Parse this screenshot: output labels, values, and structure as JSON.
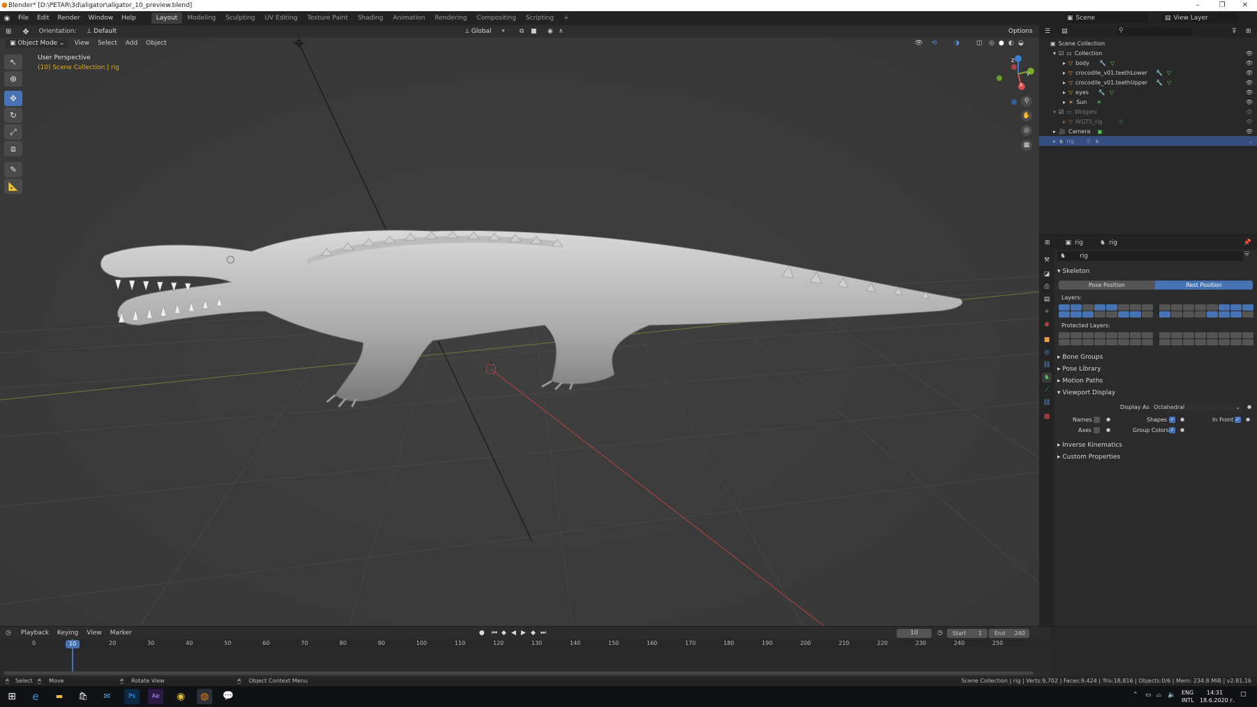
{
  "window": {
    "title": "Blender* [D:\\PETAR\\3d\\aligator\\aligator_10_preview.blend]"
  },
  "menu": [
    "File",
    "Edit",
    "Render",
    "Window",
    "Help"
  ],
  "workspaces": [
    "Layout",
    "Modeling",
    "Sculpting",
    "UV Editing",
    "Texture Paint",
    "Shading",
    "Animation",
    "Rendering",
    "Compositing",
    "Scripting"
  ],
  "scene_field": "Scene",
  "view_layer_field": "View Layer",
  "viewport": {
    "orientation_label": "Orientation:",
    "orientation_value": "Default",
    "transform_space": "Global",
    "options_label": "Options",
    "mode": "Object Mode",
    "header_menu": [
      "View",
      "Select",
      "Add",
      "Object"
    ],
    "overlay_title": "User Perspective",
    "overlay_sub": "(10) Scene Collection | rig",
    "gizmo_labels": {
      "z": "Z",
      "y": "Y",
      "x": "X"
    }
  },
  "outliner": {
    "rows": [
      {
        "label": "Scene Collection",
        "indent": 0
      },
      {
        "label": "Collection",
        "indent": 1
      },
      {
        "label": "body",
        "indent": 2
      },
      {
        "label": "crocodile_v01.teethLower",
        "indent": 2
      },
      {
        "label": "crocodile_v01.teethUpper",
        "indent": 2
      },
      {
        "label": "eyes",
        "indent": 2
      },
      {
        "label": "Sun",
        "indent": 2
      },
      {
        "label": "Widgets",
        "indent": 1
      },
      {
        "label": "WGTS_rig",
        "indent": 2
      },
      {
        "label": "Camera",
        "indent": 1
      },
      {
        "label": "rig",
        "indent": 1
      }
    ]
  },
  "properties": {
    "breadcrumb_object": "rig",
    "breadcrumb_data": "rig",
    "name_field": "rig",
    "skeleton_title": "Skeleton",
    "pose_position": "Pose Position",
    "rest_position": "Rest Position",
    "layers_label": "Layers:",
    "protected_layers_label": "Protected Layers:",
    "collapsed_panels": [
      "Bone Groups",
      "Pose Library",
      "Motion Paths"
    ],
    "viewport_display_title": "Viewport Display",
    "display_as_label": "Display As",
    "display_as_value": "Octahedral",
    "names_label": "Names",
    "shapes_label": "Shapes",
    "in_front_label": "In Front",
    "axes_label": "Axes",
    "group_colors_label": "Group Colors",
    "bottom_panels": [
      "Inverse Kinematics",
      "Custom Properties"
    ]
  },
  "timeline": {
    "menu": [
      "Playback",
      "Keying",
      "View",
      "Marker"
    ],
    "current_frame": "10",
    "start_label": "Start",
    "start_value": "1",
    "end_label": "End",
    "end_value": "240",
    "ruler": [
      "0",
      "10",
      "20",
      "30",
      "40",
      "50",
      "60",
      "70",
      "80",
      "90",
      "100",
      "110",
      "120",
      "130",
      "140",
      "150",
      "160",
      "170",
      "180",
      "190",
      "200",
      "210",
      "220",
      "230",
      "240",
      "250"
    ]
  },
  "statusbar": {
    "select": "Select",
    "move": "Move",
    "rotate_view": "Rotate View",
    "context_menu": "Object Context Menu",
    "stats": "Scene Collection | rig | Verts:9,702 | Faces:9,424 | Tris:18,816 | Objects:0/6 | Mem: 234.8 MiB | v2.81.16"
  },
  "taskbar": {
    "lang1": "ENG",
    "lang2": "INTL",
    "time": "14:31",
    "date": "18.6.2020 г."
  },
  "colors": {
    "accent": "#4772b3",
    "viewport_bg": "#3a3a3a",
    "panel_bg": "#2b2b2b"
  }
}
